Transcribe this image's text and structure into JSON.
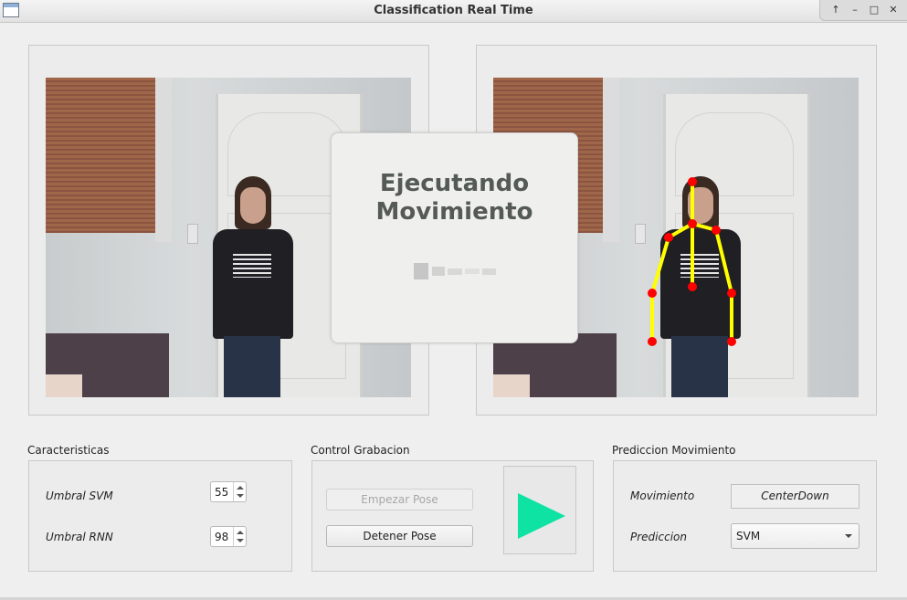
{
  "window": {
    "title": "Classification Real Time"
  },
  "overlay": {
    "line1": "Ejecutando",
    "line2": "Movimiento"
  },
  "caracteristicas": {
    "title": "Caracteristicas",
    "svm_label": "Umbral SVM",
    "svm_value": "55",
    "rnn_label": "Umbral RNN",
    "rnn_value": "98"
  },
  "control": {
    "title": "Control Grabacion",
    "start_label": "Empezar Pose",
    "start_enabled": false,
    "stop_label": "Detener Pose",
    "play_icon": "play-icon",
    "play_color": "#0ee3a3"
  },
  "prediccion": {
    "title": "Prediccion Movimiento",
    "movimiento_label": "Movimiento",
    "movimiento_value": "CenterDown",
    "prediccion_label": "Prediccion",
    "prediccion_selected": "SVM"
  },
  "skeleton": {
    "joint_color": "#ff0000",
    "bone_color": "#ffff00"
  }
}
